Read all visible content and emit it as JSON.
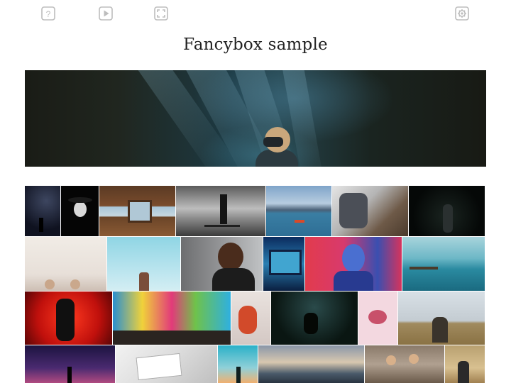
{
  "toolbar": {
    "help_label": "?",
    "icons": [
      "help-icon",
      "play-icon",
      "fullscreen-icon",
      "settings-icon"
    ]
  },
  "page": {
    "title": "Fancybox sample"
  },
  "colors": {
    "icon_stroke": "#bdbdbd",
    "title_text": "#222222",
    "background": "#ffffff"
  },
  "gallery": {
    "hero": {
      "subject": "underwater diver"
    },
    "rows": [
      [
        "starry night silhouette",
        "woman in hat",
        "boat cabin",
        "skier at sunset",
        "kayak on mountain lake",
        "business handshake",
        "dark portrait"
      ],
      [
        "two women",
        "person on teal sky",
        "smiling woman",
        "bus window",
        "man in red light",
        "pier over lake"
      ],
      [
        "concert in red",
        "colorful festival powder",
        "woman with red hair",
        "figure in dark forest",
        "mouth through paper",
        "woman in field"
      ],
      [
        "night sky figure",
        "reading newspaper",
        "silhouette at dusk",
        "mountain sunset",
        "group on steps",
        "woman in dry grass"
      ]
    ]
  }
}
